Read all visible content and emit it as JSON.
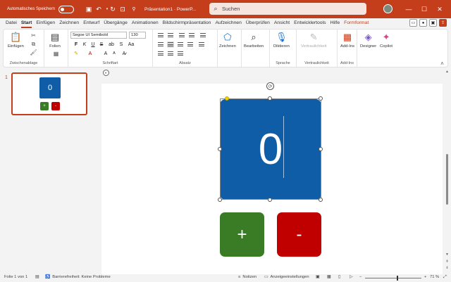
{
  "titlebar": {
    "autosave_label": "Automatisches Speichern",
    "doc_title": "Präsentation1 · PowerP...",
    "search_placeholder": "Suchen"
  },
  "tabs": [
    "Datei",
    "Start",
    "Einfügen",
    "Zeichnen",
    "Entwurf",
    "Übergänge",
    "Animationen",
    "Bildschirmpräsentation",
    "Aufzeichnen",
    "Überprüfen",
    "Ansicht",
    "Entwicklertools",
    "Hilfe",
    "Formformat"
  ],
  "ribbon": {
    "clipboard": {
      "paste": "Einfügen",
      "label": "Zwischenablage"
    },
    "slides": {
      "slides_btn": "Folien"
    },
    "font": {
      "font_name": "Segoe UI Semibold",
      "font_size": "130",
      "bold": "F",
      "italic": "K",
      "underline": "U",
      "strike": "S",
      "grow": "A",
      "shrink": "A",
      "clear": "A",
      "label": "Schriftart"
    },
    "paragraph": {
      "label": "Absatz"
    },
    "drawing": {
      "draw": "Zeichnen"
    },
    "editing": {
      "edit": "Bearbeiten"
    },
    "voice": {
      "dictate": "Diktieren",
      "label": "Sprache"
    },
    "confidentiality": {
      "btn": "Vertraulichkeit",
      "label": "Vertraulichkeit"
    },
    "addins": {
      "btn": "Add-Ins",
      "label": "Add-Ins"
    },
    "designer": "Designer",
    "copilot": "Copilot"
  },
  "thumbnail": {
    "number": "1",
    "counter": "0",
    "plus": "+",
    "minus": "-"
  },
  "slide": {
    "counter_value": "0",
    "plus_label": "+",
    "minus_label": "-"
  },
  "statusbar": {
    "slide_info": "Folie 1 von 1",
    "accessibility": "Barrierefreiheit: Keine Probleme",
    "notes": "Notizen",
    "display_settings": "Anzeigeeinstellungen",
    "zoom": "71 %"
  },
  "colors": {
    "brand": "#c43e1c",
    "counter_box": "#0f5da6",
    "plus_button": "#3a7c26",
    "minus_button": "#c00000"
  }
}
